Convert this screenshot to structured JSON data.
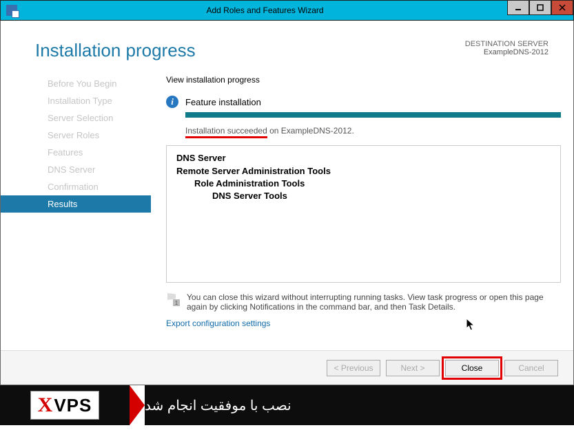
{
  "window": {
    "title": "Add Roles and Features Wizard"
  },
  "header": {
    "page_title": "Installation progress",
    "destination_label": "DESTINATION SERVER",
    "destination_value": "ExampleDNS-2012"
  },
  "sidebar": {
    "items": [
      {
        "label": "Before You Begin"
      },
      {
        "label": "Installation Type"
      },
      {
        "label": "Server Selection"
      },
      {
        "label": "Server Roles"
      },
      {
        "label": "Features"
      },
      {
        "label": "DNS Server"
      },
      {
        "label": "Confirmation"
      },
      {
        "label": "Results"
      }
    ]
  },
  "main": {
    "subheading": "View installation progress",
    "feature_label": "Feature installation",
    "status_underlined": "Installation succeeded",
    "status_rest": " on ExampleDNS-2012.",
    "results": {
      "l0": "DNS Server",
      "l1": "Remote Server Administration Tools",
      "l2": "Role Administration Tools",
      "l3": "DNS Server Tools"
    },
    "note_text": "You can close this wizard without interrupting running tasks. View task progress or open this page again by clicking Notifications in the command bar, and then Task Details.",
    "export_link": "Export configuration settings"
  },
  "footer": {
    "previous": "< Previous",
    "next": "Next >",
    "close": "Close",
    "cancel": "Cancel"
  },
  "banner": {
    "logo_x": "X",
    "logo_vps": "VPS",
    "message_fa": "نصب با موفقیت انجام شد"
  }
}
